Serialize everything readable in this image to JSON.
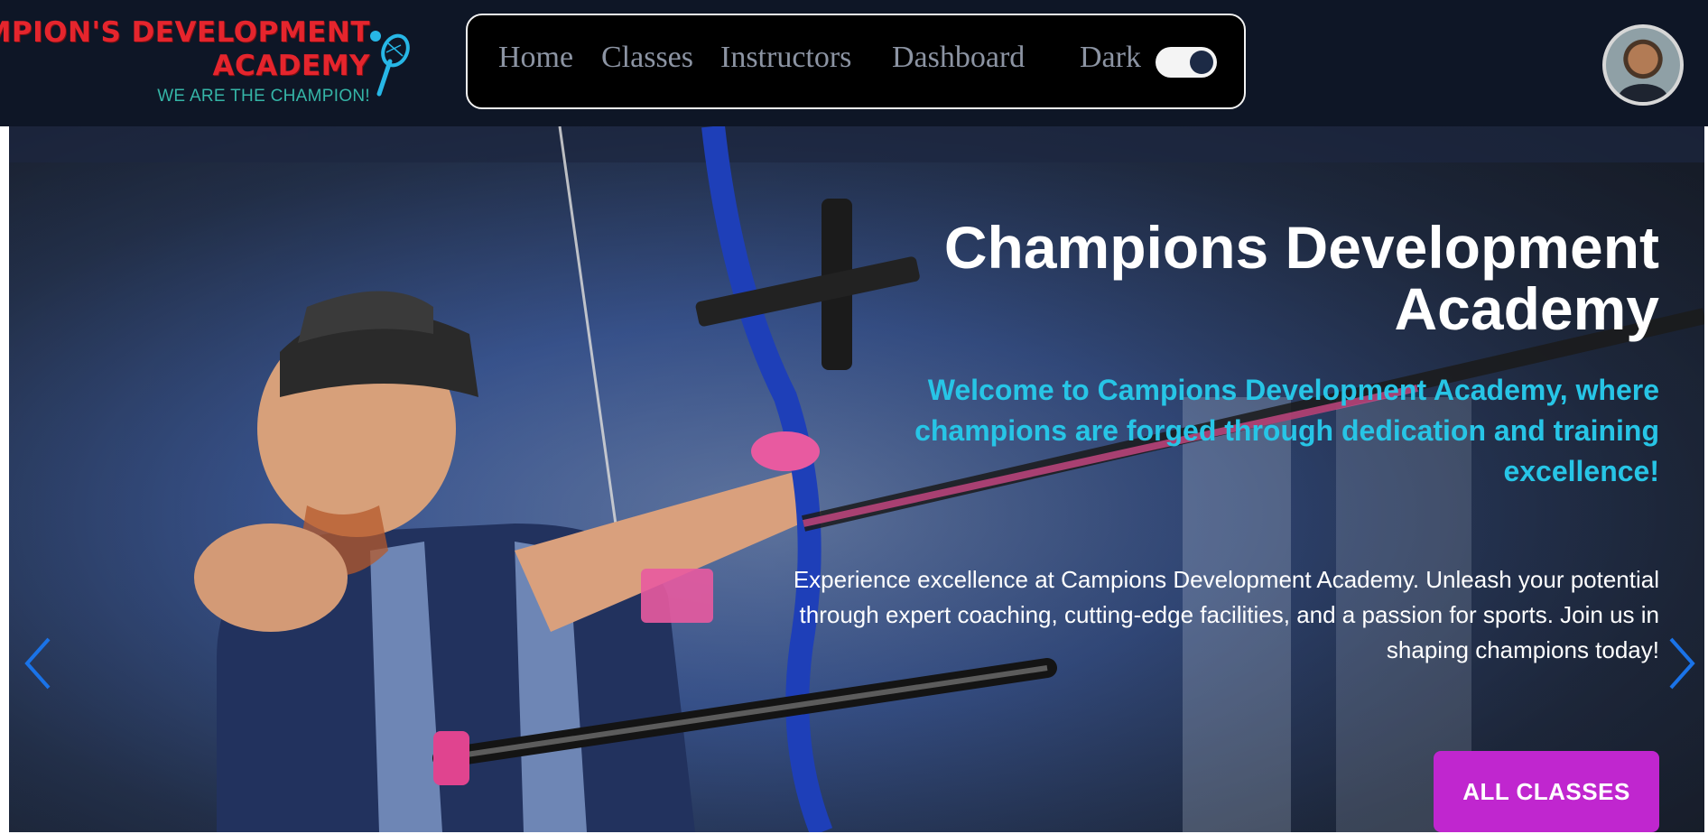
{
  "header": {
    "logo": {
      "line1": "CHAMPION'S DEVELOPMENT",
      "line2": "ACADEMY",
      "tagline": "WE ARE THE CHAMPION!"
    },
    "nav": [
      {
        "label": "Home"
      },
      {
        "label": "Classes"
      },
      {
        "label": "Instructors"
      },
      {
        "label": "Dashboard"
      }
    ],
    "theme_toggle": {
      "label": "Dark",
      "state": "on"
    },
    "avatar_icon": "user-avatar"
  },
  "hero": {
    "title": "Champions Development Academy",
    "subtitle": "Welcome to Campions Development Academy, where champions are forged through dedication and training excellence!",
    "description": "Experience excellence at Campions Development Academy. Unleash your potential through expert coaching, cutting-edge facilities, and a passion for sports. Join us in shaping champions today!",
    "cta_label": "ALL CLASSES",
    "prev_icon": "chevron-left-icon",
    "next_icon": "chevron-right-icon"
  },
  "colors": {
    "header_bg": "#0e1626",
    "accent_cyan": "#27c5e6",
    "cta_purple": "#c026cf",
    "logo_red": "#e5252d",
    "tagline_teal": "#35b5a7",
    "arrow_blue": "#1a73e8"
  }
}
